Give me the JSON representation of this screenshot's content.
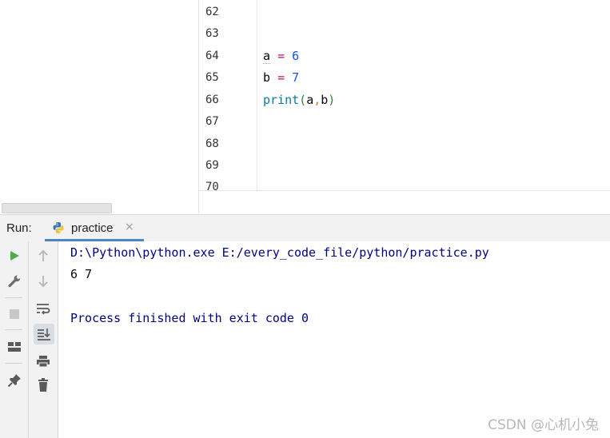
{
  "editor": {
    "line_numbers": [
      "62",
      "63",
      "64",
      "65",
      "66",
      "67",
      "68",
      "69",
      "70"
    ],
    "code_lines": [
      {
        "tokens": [
          {
            "t": "a",
            "c": "ident-a"
          },
          {
            "t": " ",
            "c": ""
          },
          {
            "t": "=",
            "c": "op"
          },
          {
            "t": " ",
            "c": ""
          },
          {
            "t": "6",
            "c": "num"
          }
        ]
      },
      {
        "tokens": [
          {
            "t": "b",
            "c": ""
          },
          {
            "t": " ",
            "c": ""
          },
          {
            "t": "=",
            "c": "op"
          },
          {
            "t": " ",
            "c": ""
          },
          {
            "t": "7",
            "c": "num"
          }
        ]
      },
      {
        "tokens": [
          {
            "t": "print",
            "c": "builtin"
          },
          {
            "t": "(",
            "c": "paren"
          },
          {
            "t": "a",
            "c": ""
          },
          {
            "t": ",",
            "c": "comma"
          },
          {
            "t": "b",
            "c": ""
          },
          {
            "t": ")",
            "c": "paren"
          }
        ]
      }
    ]
  },
  "run_window": {
    "label": "Run:",
    "tab": {
      "label": "practice",
      "icon": "python-icon",
      "close": "×"
    },
    "toolbar_left": [
      "run-icon",
      "wrench-icon",
      "stop-icon",
      "layout-icon",
      "pin-icon"
    ],
    "toolbar_right": [
      "up-arrow-icon",
      "down-arrow-icon",
      "soft-wrap-icon",
      "scroll-to-end-icon",
      "print-icon",
      "trash-icon"
    ]
  },
  "console": {
    "command": "D:\\Python\\python.exe E:/every_code_file/python/practice.py",
    "output": "6 7",
    "exit_message": "Process finished with exit code 0"
  },
  "watermark": "CSDN @心机小兔",
  "colors": {
    "accent_tab": "#4a86c7",
    "run_green": "#4cae4f",
    "console_blue": "#000080"
  }
}
